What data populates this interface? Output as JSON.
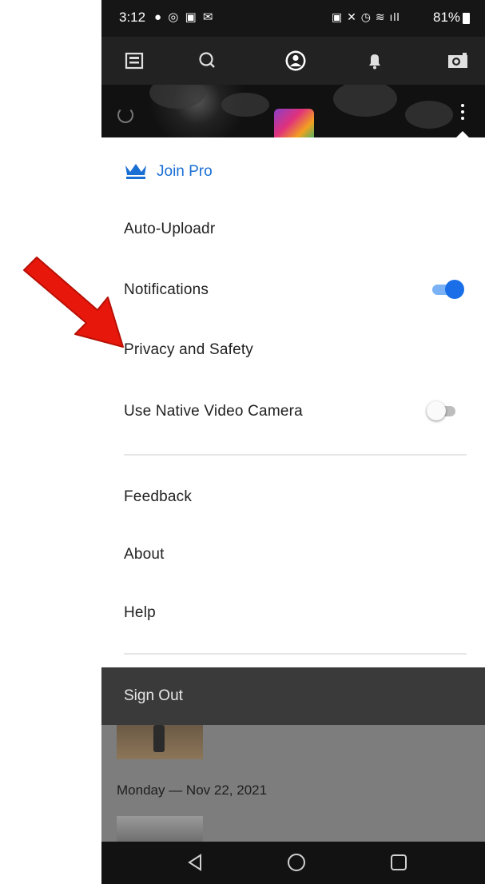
{
  "status_bar": {
    "time": "3:12",
    "left_icons": "● ◎ ▣ ✉",
    "right_icons": "▣ ✕ ◷ ≋ ıll",
    "battery_percent": "81%"
  },
  "top_nav": {
    "icons": [
      "feed-icon",
      "search-icon",
      "profile-icon",
      "bell-icon",
      "camera-icon"
    ]
  },
  "menu": {
    "join_pro": "Join Pro",
    "auto_uploadr": "Auto-Uploadr",
    "notifications": "Notifications",
    "notifications_toggle": true,
    "privacy_and_safety": "Privacy and Safety",
    "use_native_video_camera": "Use Native Video Camera",
    "native_video_toggle": false,
    "feedback": "Feedback",
    "about": "About",
    "help": "Help"
  },
  "sign_out": "Sign Out",
  "feed": {
    "date_label": "Monday — Nov 22, 2021"
  },
  "colors": {
    "accent": "#1a6fd4",
    "annotation_arrow": "#e8170b"
  }
}
